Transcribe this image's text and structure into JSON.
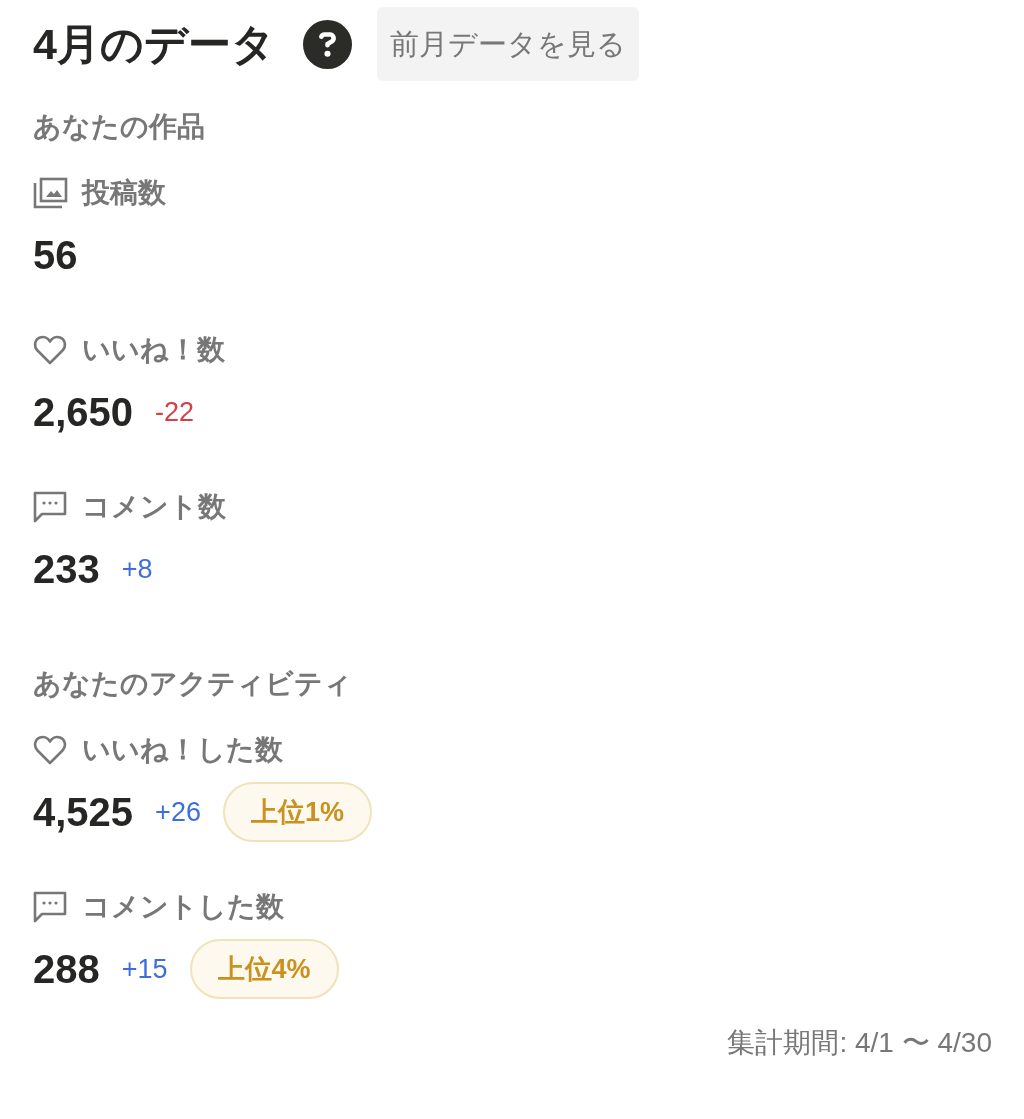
{
  "header": {
    "title": "4月のデータ",
    "button": "前月データを見る"
  },
  "sections": [
    {
      "heading": "あなたの作品",
      "metrics": [
        {
          "kind": "posts",
          "label": "投稿数",
          "value": "56"
        },
        {
          "kind": "likes",
          "label": "いいね！数",
          "value": "2,650",
          "delta": "-22",
          "color": "#d3404a"
        },
        {
          "kind": "comments",
          "label": "コメント数",
          "value": "233",
          "delta": "+8",
          "color": "#3e6fd8"
        }
      ]
    },
    {
      "heading": "あなたのアクティビティ",
      "metrics": [
        {
          "kind": "likes",
          "label": "いいね！した数",
          "value": "4,525",
          "delta": "+26",
          "color": "#3e6fd8",
          "badge": "上位1%"
        },
        {
          "kind": "comments",
          "label": "コメントした数",
          "value": "288",
          "delta": "+15",
          "color": "#3e6fd8",
          "badge": "上位4%"
        }
      ]
    }
  ],
  "footer": "集計期間: 4/1 〜 4/30"
}
